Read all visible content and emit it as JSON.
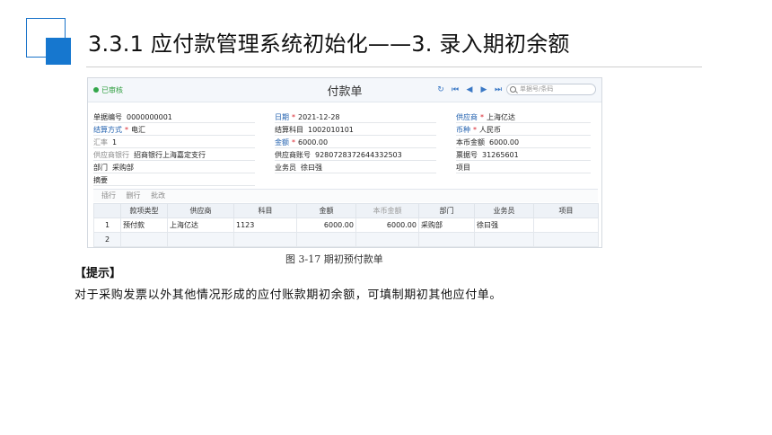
{
  "slide": {
    "title": "3.3.1  应付款管理系统初始化——3. 录入期初余额",
    "figure_caption": "图 3-17  期初预付款单",
    "tip_heading": "【提示】",
    "tip_text": "对于采购发票以外其他情况形成的应付账款期初余额，可填制期初其他应付单。"
  },
  "form": {
    "status": "已审核",
    "title": "付款单",
    "nav_icons": [
      "refresh-icon",
      "first-icon",
      "prev-icon",
      "next-icon",
      "last-icon"
    ],
    "search_placeholder": "单据号/条码",
    "fields": {
      "doc_no": {
        "label": "单据编号",
        "value": "0000000001"
      },
      "date": {
        "label": "日期",
        "required": "*",
        "value": "2021-12-28"
      },
      "supplier": {
        "label": "供应商",
        "required": "*",
        "value": "上海亿达"
      },
      "settle_method": {
        "label": "结算方式",
        "required": "*",
        "value": "电汇"
      },
      "settle_account": {
        "label": "结算科目",
        "value": "1002010101"
      },
      "currency": {
        "label": "币种",
        "required": "*",
        "value": "人民币"
      },
      "rate": {
        "label": "汇率",
        "value": "1"
      },
      "amount": {
        "label": "金额",
        "required": "*",
        "value": "6000.00"
      },
      "local_amount": {
        "label": "本币金额",
        "value": "6000.00"
      },
      "supplier_bank": {
        "label": "供应商银行",
        "value": "招商银行上海嘉定支行"
      },
      "supplier_account": {
        "label": "供应商账号",
        "value": "9280728372644332503"
      },
      "bill_no": {
        "label": "票据号",
        "value": "31265601"
      },
      "dept": {
        "label": "部门",
        "value": "采购部"
      },
      "clerk": {
        "label": "业务员",
        "value": "徐曰强"
      },
      "project": {
        "label": "项目",
        "value": ""
      },
      "memo": {
        "label": "摘要",
        "value": ""
      }
    },
    "grid_toolbar": [
      "插行",
      "删行",
      "批改"
    ],
    "grid": {
      "headers": [
        "",
        "款项类型",
        "供应商",
        "科目",
        "金额",
        "本币金额",
        "部门",
        "业务员",
        "项目"
      ],
      "rows": [
        [
          "1",
          "预付款",
          "上海亿达",
          "1123",
          "6000.00",
          "6000.00",
          "采购部",
          "徐曰强",
          ""
        ],
        [
          "2",
          "",
          "",
          "",
          "",
          "",
          "",
          "",
          ""
        ]
      ]
    }
  },
  "colors": {
    "accent": "#1677cf",
    "status_green": "#2e9e3e",
    "label_blue": "#1f5fae",
    "required_red": "#d9262f"
  }
}
